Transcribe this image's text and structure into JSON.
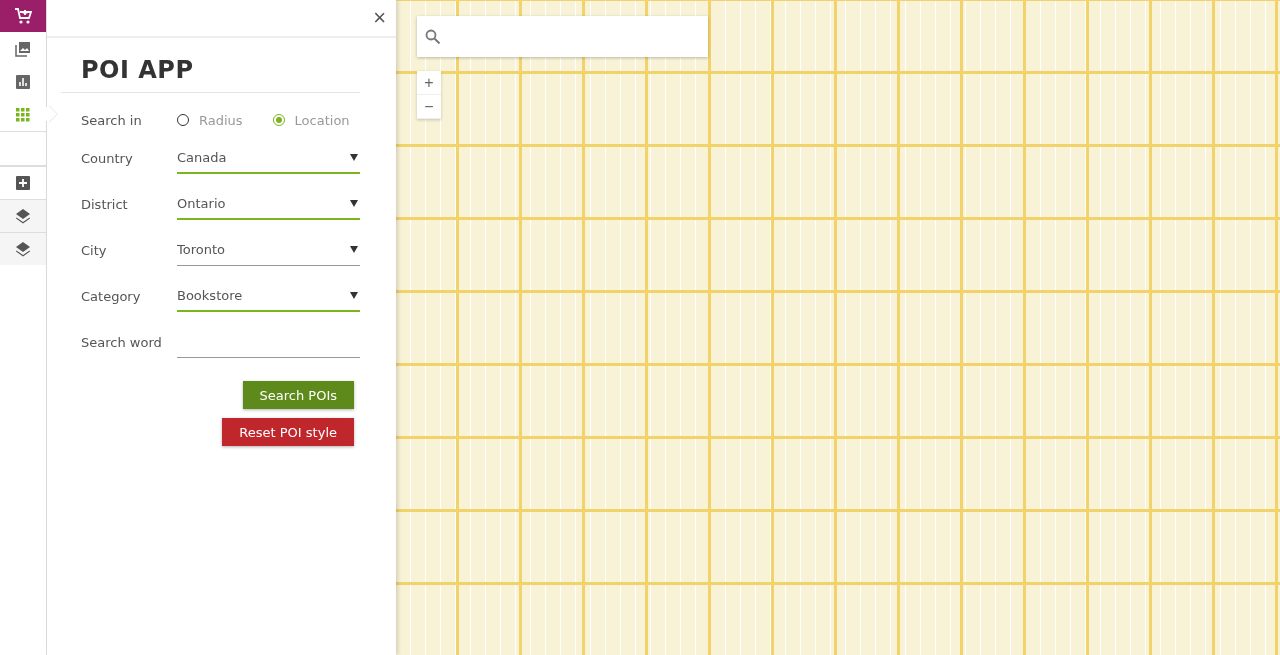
{
  "sidebar": {
    "items": [
      {
        "kind": "cart",
        "selected": false
      },
      {
        "kind": "gallery",
        "selected": false
      },
      {
        "kind": "chart",
        "selected": false
      },
      {
        "kind": "grid",
        "selected": true
      },
      {
        "kind": "blank",
        "selected": false
      },
      {
        "kind": "add",
        "selected": false
      },
      {
        "kind": "layers",
        "selected": false
      },
      {
        "kind": "layers",
        "selected": false
      }
    ]
  },
  "panel": {
    "close": "×",
    "title": "POI APP",
    "search_in": {
      "label": "Search in",
      "options": [
        {
          "label": "Radius",
          "selected": false
        },
        {
          "label": "Location",
          "selected": true
        }
      ]
    },
    "fields": [
      {
        "kind": "dropdown",
        "label": "Country",
        "value": "Canada",
        "active": true
      },
      {
        "kind": "dropdown",
        "label": "District",
        "value": "Ontario",
        "active": true
      },
      {
        "kind": "dropdown",
        "label": "City",
        "value": "Toronto",
        "active": false
      },
      {
        "kind": "dropdown",
        "label": "Category",
        "value": "Bookstore",
        "active": true
      },
      {
        "kind": "text",
        "label": "Search word",
        "active": false
      }
    ],
    "buttons": [
      {
        "label": "Search POIs",
        "kind": "primary"
      },
      {
        "label": "Reset POI style",
        "kind": "danger"
      }
    ]
  },
  "map": {
    "zoom": [
      "+",
      "−"
    ]
  }
}
